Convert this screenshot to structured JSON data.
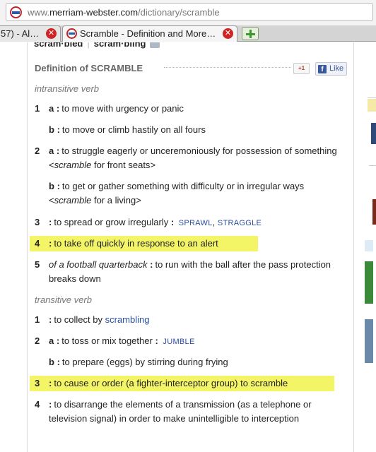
{
  "browser": {
    "url_prefix": "www.",
    "url_host": "merriam-webster.com",
    "url_path": "/dictionary/scramble",
    "tabs": [
      {
        "label": "57) - Al…"
      },
      {
        "label": "Scramble - Definition and More…"
      }
    ]
  },
  "page": {
    "top_cut_left": "scram·bled",
    "top_cut_right": "scram·bling",
    "heading": "Definition of SCRAMBLE",
    "gplus_label": "+1",
    "fb_label": "Like",
    "intransitive_label": "intransitive verb",
    "transitive_label": "transitive verb",
    "intransitive": [
      {
        "num": "1",
        "letter": "a",
        "text": "to move with urgency or panic"
      },
      {
        "num": "",
        "letter": "b",
        "text": "to move or climb hastily on all fours"
      },
      {
        "num": "2",
        "letter": "a",
        "text": "to struggle eagerly or unceremoniously for possession of something ",
        "ex_word": "scramble",
        "ex_rest": " for front seats",
        "ex_open": "<",
        "ex_close": ">"
      },
      {
        "num": "",
        "letter": "b",
        "text": "to get or gather something with difficulty or in irregular ways ",
        "ex_word": "scramble",
        "ex_rest": " for a living",
        "ex_open": "<",
        "ex_close": ">"
      },
      {
        "num": "3",
        "text": "to spread or grow irregularly ",
        "syn1": "SPRAWL",
        "syn_sep": ",",
        "syn2": "STRAGGLE"
      },
      {
        "num": "4",
        "text": "to take off quickly in response to an alert"
      },
      {
        "num": "5",
        "sub": "of a football quarterback",
        "text": "to run with the ball after the pass protection breaks down"
      }
    ],
    "transitive": [
      {
        "num": "1",
        "text": "to collect by ",
        "xref": "scrambling"
      },
      {
        "num": "2",
        "letter": "a",
        "text": "to toss or mix together ",
        "syn1": "JUMBLE"
      },
      {
        "num": "",
        "letter": "b",
        "text": "to prepare (eggs) by stirring during frying"
      },
      {
        "num": "3",
        "text": "to cause or order (a fighter-interceptor group) to scramble"
      },
      {
        "num": "4",
        "text": "to disarrange the elements of a transmission (as a telephone or television signal) in order to make unintelligible to interception"
      }
    ],
    "highlight_color": "#f3f566",
    "link_color": "#2b4ea3"
  }
}
